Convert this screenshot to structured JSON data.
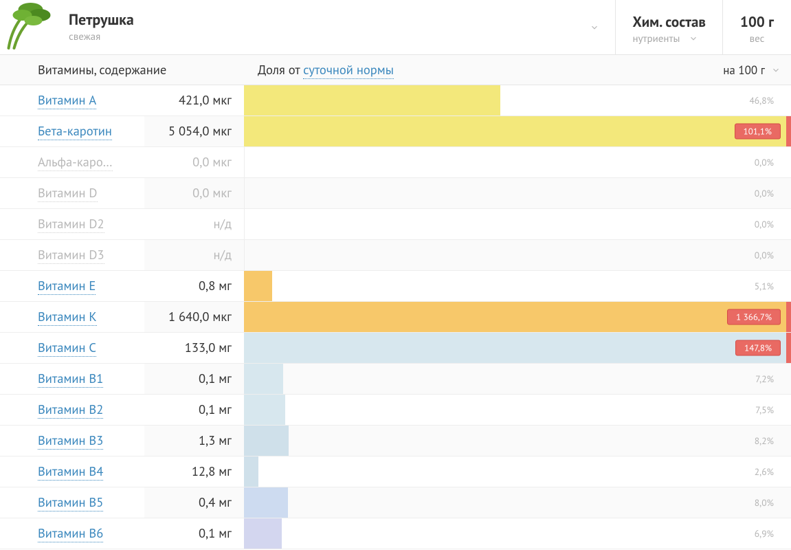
{
  "header": {
    "food_title": "Петрушка",
    "food_sub": "свежая",
    "box_comp": {
      "title": "Хим. состав",
      "sub": "нутриенты"
    },
    "box_amount": {
      "title": "100 г",
      "sub": "вес"
    }
  },
  "columns": {
    "name_header": "Витамины, содержание",
    "bar_header_prefix": "Доля от ",
    "bar_header_link": "суточной нормы",
    "per_label": "на 100 г"
  },
  "chart_data": {
    "type": "bar",
    "title": "Витамины — доля от суточной нормы (на 100 г)",
    "xlabel": "Доля от суточной нормы, %",
    "ylabel": "",
    "ylim": [
      0,
      100
    ],
    "rows": [
      {
        "name": "Витамин A",
        "amount": "421,0 мкг",
        "pct_label": "46,8%",
        "pct": 46.8,
        "color": "#f3e87b",
        "link_active": true
      },
      {
        "name": "Бета-каротин",
        "amount": "5 054,0 мкг",
        "pct_label": "101,1%",
        "pct": 101.1,
        "color": "#f3e87b",
        "link_active": true
      },
      {
        "name": "Альфа-каро…",
        "amount": "0,0 мкг",
        "pct_label": "0,0%",
        "pct": 0.0,
        "color": "",
        "link_active": false
      },
      {
        "name": "Витамин D",
        "amount": "0,0 мкг",
        "pct_label": "0,0%",
        "pct": 0.0,
        "color": "",
        "link_active": false
      },
      {
        "name": "Витамин D2",
        "amount": "н/д",
        "pct_label": "0,0%",
        "pct": 0.0,
        "color": "",
        "link_active": false
      },
      {
        "name": "Витамин D3",
        "amount": "н/д",
        "pct_label": "0,0%",
        "pct": 0.0,
        "color": "",
        "link_active": false
      },
      {
        "name": "Витамин E",
        "amount": "0,8 мг",
        "pct_label": "5,1%",
        "pct": 5.1,
        "color": "#f7c86a",
        "link_active": true
      },
      {
        "name": "Витамин K",
        "amount": "1 640,0 мкг",
        "pct_label": "1 366,7%",
        "pct": 1366.7,
        "color": "#f7c86a",
        "link_active": true
      },
      {
        "name": "Витамин C",
        "amount": "133,0 мг",
        "pct_label": "147,8%",
        "pct": 147.8,
        "color": "#d7e7ee",
        "link_active": true
      },
      {
        "name": "Витамин B1",
        "amount": "0,1 мг",
        "pct_label": "7,2%",
        "pct": 7.2,
        "color": "#d7e7ee",
        "link_active": true
      },
      {
        "name": "Витамин B2",
        "amount": "0,1 мг",
        "pct_label": "7,5%",
        "pct": 7.5,
        "color": "#d7e7ee",
        "link_active": true
      },
      {
        "name": "Витамин B3",
        "amount": "1,3 мг",
        "pct_label": "8,2%",
        "pct": 8.2,
        "color": "#cfe0ea",
        "link_active": true
      },
      {
        "name": "Витамин B4",
        "amount": "12,8 мг",
        "pct_label": "2,6%",
        "pct": 2.6,
        "color": "#cfe0ea",
        "link_active": true
      },
      {
        "name": "Витамин B5",
        "amount": "0,4 мг",
        "pct_label": "8,0%",
        "pct": 8.0,
        "color": "#cddbf0",
        "link_active": true
      },
      {
        "name": "Витамин B6",
        "amount": "0,1 мг",
        "pct_label": "6,9%",
        "pct": 6.9,
        "color": "#d3d6ef",
        "link_active": true
      }
    ]
  }
}
